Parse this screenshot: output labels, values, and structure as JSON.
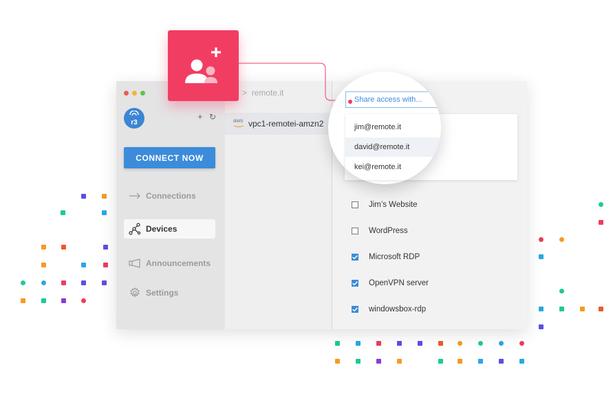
{
  "app": {
    "breadcrumb": {
      "separator": ">",
      "path": "remote.it"
    },
    "connect_button_label": "CONNECT NOW",
    "nav": [
      {
        "label": "Connections",
        "icon": "arrow-right-icon",
        "active": false
      },
      {
        "label": "Devices",
        "icon": "network-icon",
        "active": true
      },
      {
        "label": "Announcements",
        "icon": "megaphone-icon",
        "active": false
      },
      {
        "label": "Settings",
        "icon": "gear-icon",
        "active": false
      }
    ],
    "header_icons": {
      "add": "+",
      "refresh": "↻"
    },
    "logo_text": "r3"
  },
  "device": {
    "provider": "aws",
    "name": "vpc1-remotei-amzn2"
  },
  "share": {
    "placeholder": "Share access with...",
    "suggestions": [
      "jim@remote.it",
      "david@remote.it",
      "kei@remote.it"
    ],
    "highlighted_index": 1
  },
  "services": [
    {
      "label": "Jim’s Website",
      "checked": false
    },
    {
      "label": "WordPress",
      "checked": false
    },
    {
      "label": "Microsoft RDP",
      "checked": true
    },
    {
      "label": "OpenVPN server",
      "checked": true
    },
    {
      "label": "windowsbox-rdp",
      "checked": true
    }
  ],
  "colors": {
    "accent": "#3c8cdb",
    "brand_pink": "#f23d63",
    "confetti": [
      "#5b4ee8",
      "#f59b23",
      "#1dc99a",
      "#ee3c5e",
      "#ea5b2a",
      "#8d3ad9",
      "#2aa7e8"
    ]
  }
}
